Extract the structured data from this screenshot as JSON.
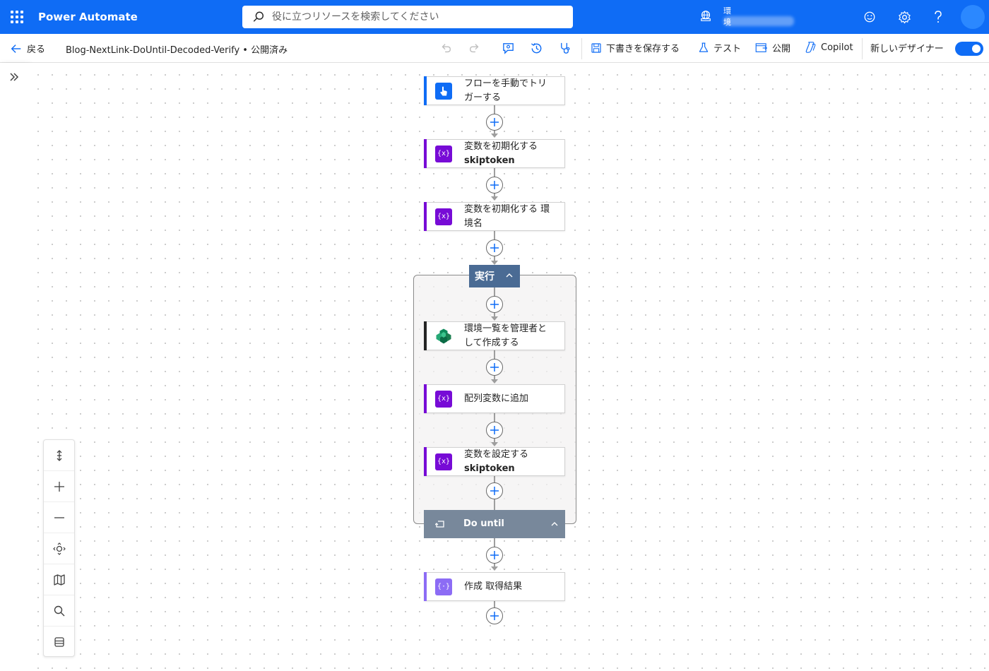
{
  "header": {
    "app_name": "Power Automate",
    "search_placeholder": "役に立つリソースを検索してください",
    "environment_label": "環境"
  },
  "command_bar": {
    "back_label": "戻る",
    "flow_name": "Blog-NextLink-DoUntil-Decoded-Verify • 公開済み",
    "save_draft_label": "下書きを保存する",
    "test_label": "テスト",
    "publish_label": "公開",
    "copilot_label": "Copilot",
    "new_designer_label": "新しいデザイナー",
    "new_designer_on": true
  },
  "flow": {
    "trigger": {
      "title": "フローを手動でトリガーする",
      "line1": "フローを手動でトリ",
      "line2": "ガーする",
      "color": "#0f6cf5"
    },
    "init_var_1": {
      "title": "変数を初期化する",
      "subtitle": "skiptoken",
      "color": "#770bd6"
    },
    "init_var_2": {
      "line1": "変数を初期化する 環",
      "line2": "境名",
      "color": "#770bd6"
    },
    "scope": {
      "label": "実行",
      "color": "#4a6b94"
    },
    "list_envs": {
      "line1": "環境一覧を管理者と",
      "line2": "して作成する",
      "color": "#242424"
    },
    "append_array": {
      "title": "配列変数に追加",
      "color": "#770bd6"
    },
    "set_var": {
      "title": "変数を設定する",
      "subtitle": "skiptoken",
      "color": "#770bd6"
    },
    "do_until": {
      "label": "Do until",
      "color": "#78889b"
    },
    "compose": {
      "title": "作成 取得結果",
      "color": "#8c6cf5"
    }
  },
  "icons": {
    "variable": "{x}",
    "compose": "{·}"
  }
}
